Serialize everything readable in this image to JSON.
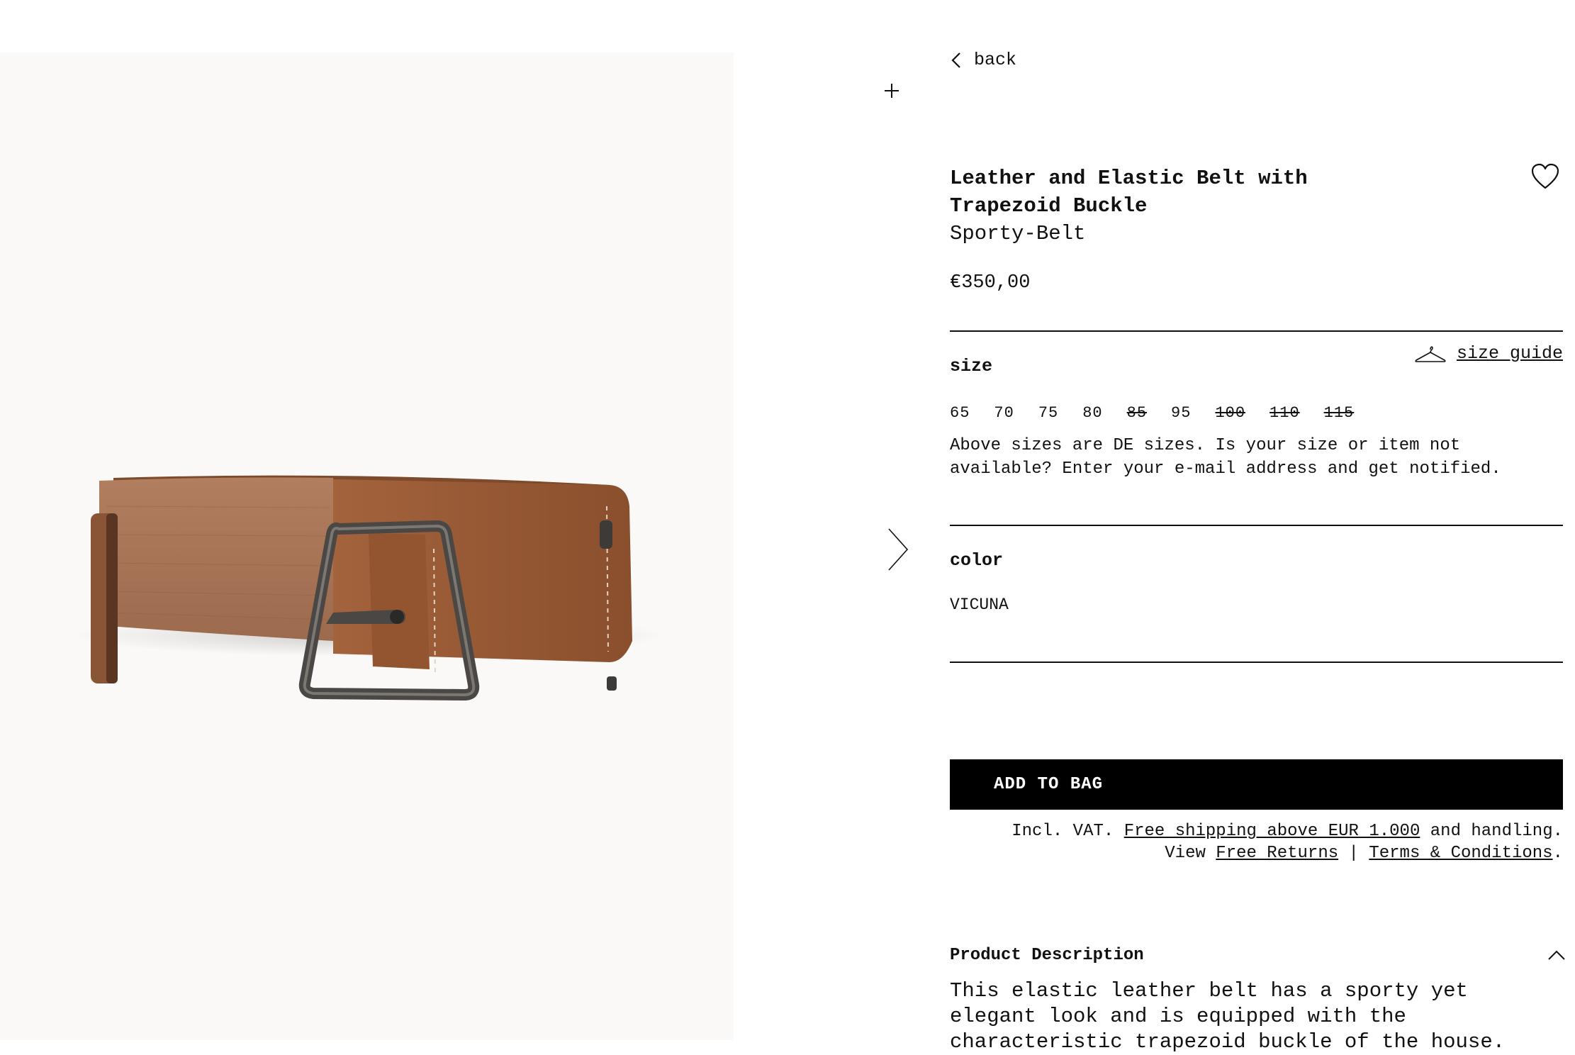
{
  "navigation": {
    "back_label": "back"
  },
  "product": {
    "title": "Leather and Elastic Belt with Trapezoid Buckle",
    "subtitle": "Sporty-Belt",
    "price": "€350,00",
    "image_alt": "Brown leather and elastic belt with trapezoid buckle"
  },
  "size": {
    "label": "size",
    "guide_label": "size guide",
    "options": [
      {
        "label": "65",
        "available": true
      },
      {
        "label": "70",
        "available": true
      },
      {
        "label": "75",
        "available": true
      },
      {
        "label": "80",
        "available": true
      },
      {
        "label": "85",
        "available": false
      },
      {
        "label": "95",
        "available": true
      },
      {
        "label": "100",
        "available": false
      },
      {
        "label": "110",
        "available": false
      },
      {
        "label": "115",
        "available": false
      }
    ],
    "note": "Above sizes are DE sizes. Is your size or item not available? Enter your e-mail address and get notified."
  },
  "color": {
    "label": "color",
    "value": "VICUNA"
  },
  "cart": {
    "add_label": "ADD TO BAG"
  },
  "shipping": {
    "prefix": "Incl. VAT. ",
    "free_shipping_link": "Free shipping above EUR 1.000",
    "suffix": " and handling.",
    "view": "View ",
    "free_returns_link": "Free Returns",
    "separator": " | ",
    "terms_link": "Terms & Conditions",
    "end": "."
  },
  "description": {
    "heading": "Product Description",
    "body": "This elastic leather belt has a sporty yet elegant look and is equipped with the characteristic trapezoid buckle of the house. Available in a wide"
  },
  "icons": {
    "zoom": "plus-icon",
    "next": "chevron-right-icon",
    "back": "chevron-left-icon",
    "wishlist": "heart-icon",
    "size_guide": "hanger-icon",
    "collapse": "chevron-up-icon"
  },
  "colors": {
    "belt_elastic": "#a87456",
    "belt_leather": "#9a5a35",
    "buckle": "#4a4744",
    "image_bg": "#faf9f7",
    "button_bg": "#000000"
  }
}
